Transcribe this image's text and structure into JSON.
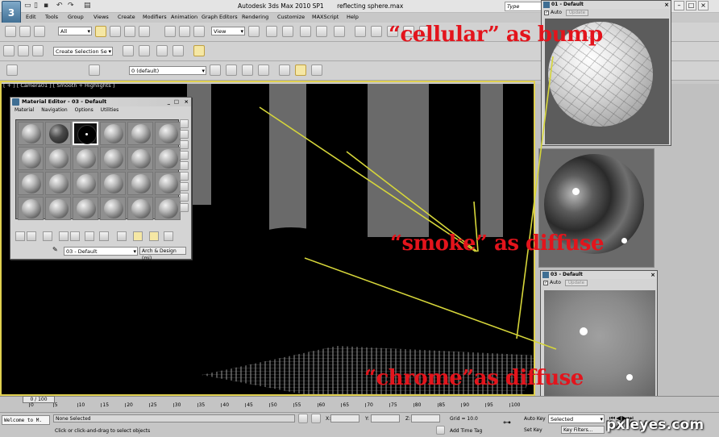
{
  "app": {
    "title": "Autodesk 3ds Max  2010 SP1",
    "file": "reflecting sphere.max",
    "search_placeholder": "Type"
  },
  "menu": [
    "Edit",
    "Tools",
    "Group",
    "Views",
    "Create",
    "Modifiers",
    "Animation",
    "Graph Editors",
    "Rendering",
    "Customize",
    "MAXScript",
    "Help"
  ],
  "toolbar": {
    "filter_value": "All",
    "coord_value": "View",
    "selection_set_placeholder": "Create Selection Se",
    "layer_value": "0 (default)"
  },
  "viewport": {
    "label": "[ + ] [ Camera01 ] [ Smooth + Highlights ]"
  },
  "material_editor": {
    "title": "Material Editor - 03 - Default",
    "menu": [
      "Material",
      "Navigation",
      "Options",
      "Utilities"
    ],
    "material_name": "03 - Default",
    "material_type": "Arch & Design (mi)"
  },
  "float_panels": [
    {
      "title": "01 - Default",
      "auto_label": "Auto",
      "update_label": "Update"
    },
    {
      "title": "03 - Default",
      "auto_label": "Auto",
      "update_label": "Update"
    }
  ],
  "annotations": {
    "bump": "“cellular” as bump",
    "smoke": "“smoke” as diffuse",
    "chrome": "“chrome”as diffuse"
  },
  "timeline": {
    "frame": "0 / 100",
    "ticks": [
      "0",
      "5",
      "10",
      "15",
      "20",
      "25",
      "30",
      "35",
      "40",
      "45",
      "50",
      "55",
      "60",
      "65",
      "70",
      "75",
      "80",
      "85",
      "90",
      "95",
      "100"
    ]
  },
  "status": {
    "listener": "Welcome to M.",
    "selection": "None Selected",
    "prompt": "Click or click-and-drag to select objects",
    "x_label": "X:",
    "y_label": "Y:",
    "z_label": "Z:",
    "grid": "Grid = 10.0",
    "add_time_tag": "Add Time Tag",
    "auto_key": "Auto Key",
    "auto_key_value": "Selected",
    "set_key": "Set Key",
    "key_filters": "Key Filters..."
  },
  "watermark": "pxleyes.com",
  "colors": {
    "annotation": "#e3141c",
    "leader_lines": "#d6d63a",
    "viewport_frame": "#e0d050"
  }
}
